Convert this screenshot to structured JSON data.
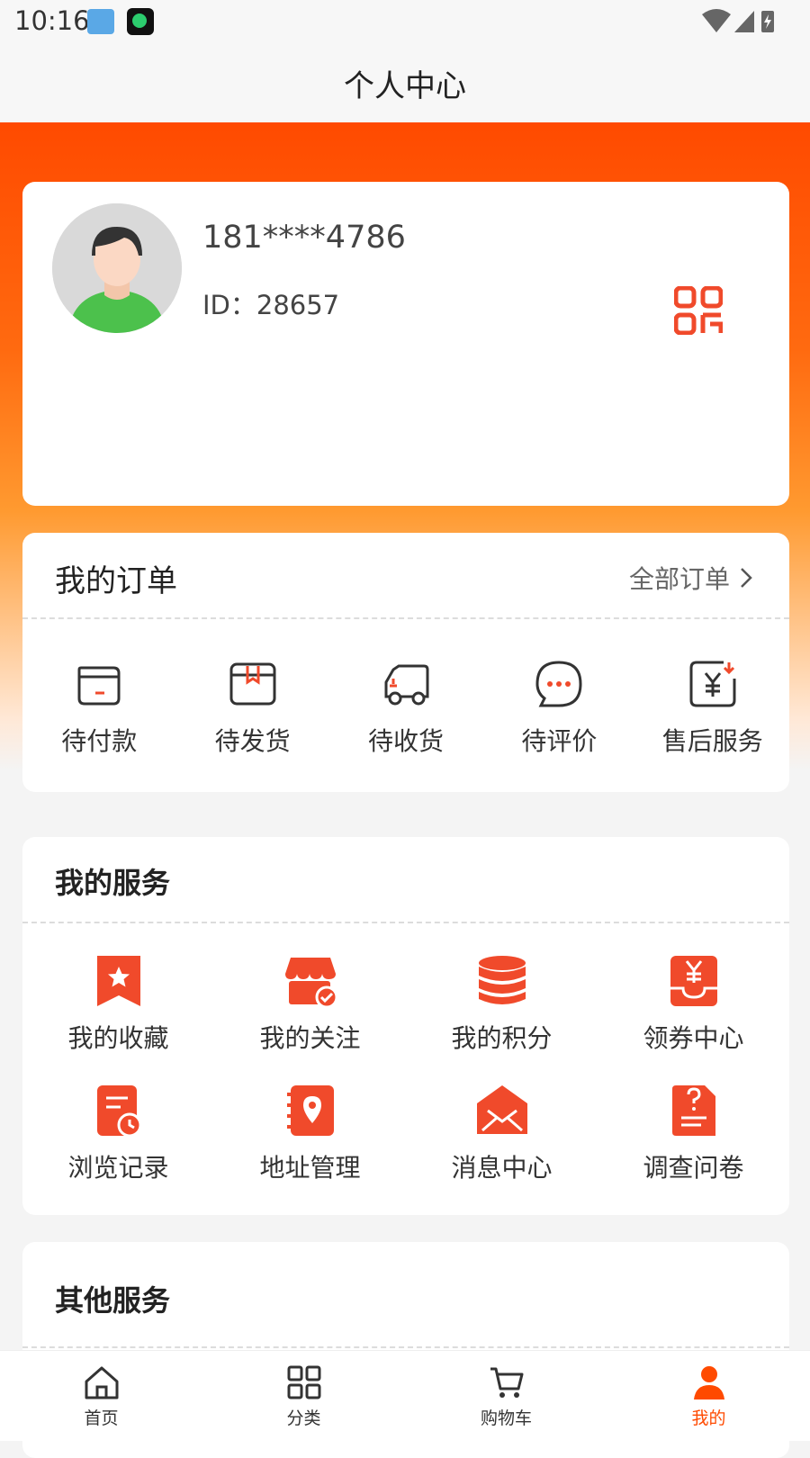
{
  "status": {
    "time": "10:16"
  },
  "header": {
    "title": "个人中心"
  },
  "profile": {
    "phone": "181****4786",
    "id_text": "ID：28657"
  },
  "orders": {
    "title": "我的订单",
    "all_label": "全部订单",
    "items": [
      {
        "label": "待付款",
        "icon": "wallet-icon"
      },
      {
        "label": "待发货",
        "icon": "package-icon"
      },
      {
        "label": "待收货",
        "icon": "truck-icon"
      },
      {
        "label": "待评价",
        "icon": "chat-bubble-icon"
      },
      {
        "label": "售后服务",
        "icon": "refund-icon"
      }
    ]
  },
  "services": {
    "title": "我的服务",
    "items": [
      {
        "label": "我的收藏",
        "icon": "bookmark-star-icon"
      },
      {
        "label": "我的关注",
        "icon": "store-check-icon"
      },
      {
        "label": "我的积分",
        "icon": "coin-stack-icon"
      },
      {
        "label": "领券中心",
        "icon": "coupon-icon"
      },
      {
        "label": "浏览记录",
        "icon": "history-doc-icon"
      },
      {
        "label": "地址管理",
        "icon": "address-book-icon"
      },
      {
        "label": "消息中心",
        "icon": "envelope-icon"
      },
      {
        "label": "调查问卷",
        "icon": "survey-icon"
      }
    ]
  },
  "other": {
    "title": "其他服务"
  },
  "tabbar": {
    "items": [
      {
        "label": "首页",
        "icon": "home-icon"
      },
      {
        "label": "分类",
        "icon": "grid-icon"
      },
      {
        "label": "购物车",
        "icon": "cart-icon"
      },
      {
        "label": "我的",
        "icon": "user-icon"
      }
    ],
    "active_index": 3
  },
  "colors": {
    "accent": "#ff4a00",
    "icon_red": "#f04a2b"
  }
}
